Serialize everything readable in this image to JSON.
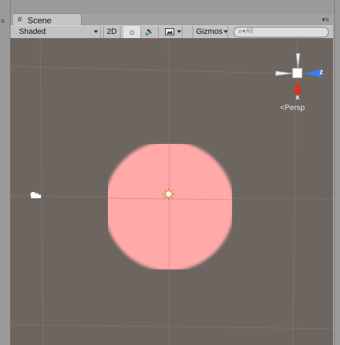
{
  "window": {
    "tab_title": "Scene",
    "tab_icon": "scene-grid-icon"
  },
  "toolbar": {
    "draw_mode": "Shaded",
    "mode_2d_label": "2D",
    "lighting_icon": "sun-icon",
    "audio_icon": "speaker-icon",
    "effects_icon": "image-icon",
    "gizmos_label": "Gizmos",
    "search_placeholder": "All"
  },
  "viewport": {
    "background_color": "#6d6560",
    "sphere_color": "#ffaaaa",
    "orientation_gizmo": {
      "z_label": "z",
      "x_label": "x",
      "projection_label": "Persp"
    }
  }
}
